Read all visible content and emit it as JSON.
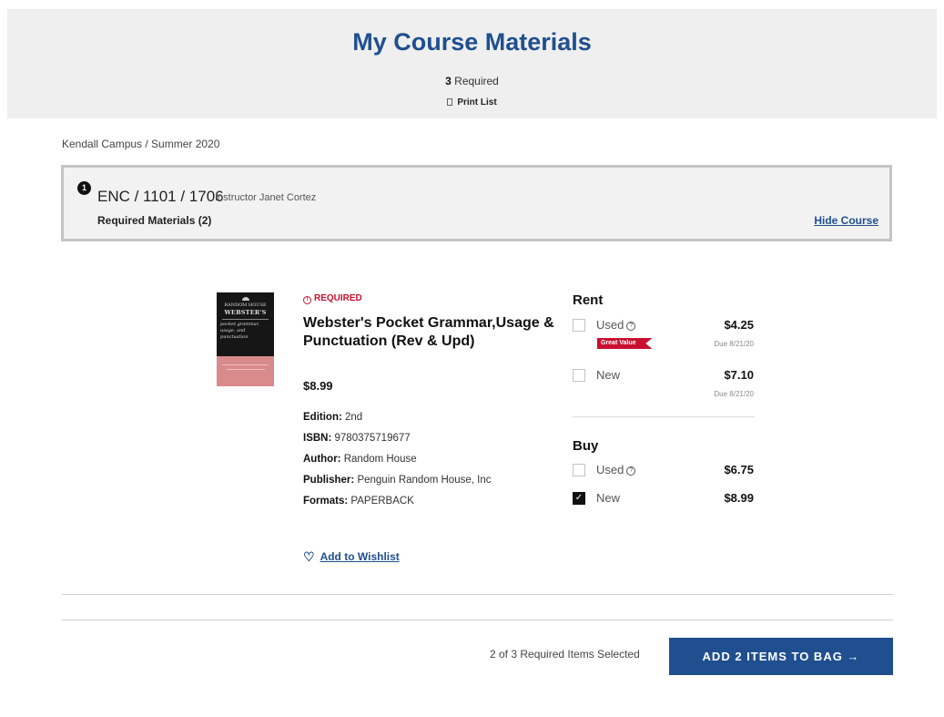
{
  "header": {
    "title": "My Course Materials",
    "required_count": "3",
    "required_label": "Required",
    "print_list": "Print List"
  },
  "breadcrumb": "Kendall Campus / Summer 2020",
  "course": {
    "number": "1",
    "code": "ENC / 1101 / 1706",
    "instructor": "Instructor Janet Cortez",
    "required_materials": "Required Materials (2)",
    "hide_course": "Hide Course"
  },
  "book": {
    "required_tag": "REQUIRED",
    "title": "Webster's Pocket Grammar,Usage & Punctuation (Rev & Upd)",
    "price": "$8.99",
    "cover": {
      "publisher": "RANDOM HOUSE",
      "title": "WEBSTER'S",
      "subtitle": "pocket grammar, usage, and punctuation"
    },
    "details": [
      {
        "label": "Edition:",
        "value": "2nd"
      },
      {
        "label": "ISBN:",
        "value": "9780375719677"
      },
      {
        "label": "Author:",
        "value": "Random House"
      },
      {
        "label": "Publisher:",
        "value": "Penguin Random House, Inc"
      },
      {
        "label": "Formats:",
        "value": "PAPERBACK"
      }
    ],
    "wishlist": "Add to Wishlist"
  },
  "options": {
    "rent": {
      "heading": "Rent",
      "used": {
        "label": "Used",
        "price": "$4.25",
        "due": "Due 8/21/20",
        "badge": "Great Value",
        "checked": false
      },
      "new": {
        "label": "New",
        "price": "$7.10",
        "due": "Due 8/21/20",
        "checked": false
      }
    },
    "buy": {
      "heading": "Buy",
      "used": {
        "label": "Used",
        "price": "$6.75",
        "checked": false
      },
      "new": {
        "label": "New",
        "price": "$8.99",
        "checked": true
      }
    }
  },
  "footer": {
    "selected": "2 of 3 Required Items Selected",
    "add_button": "ADD 2 ITEMS TO BAG →"
  },
  "colors": {
    "brand": "#1f4f8f",
    "required_red": "#c8102e"
  }
}
